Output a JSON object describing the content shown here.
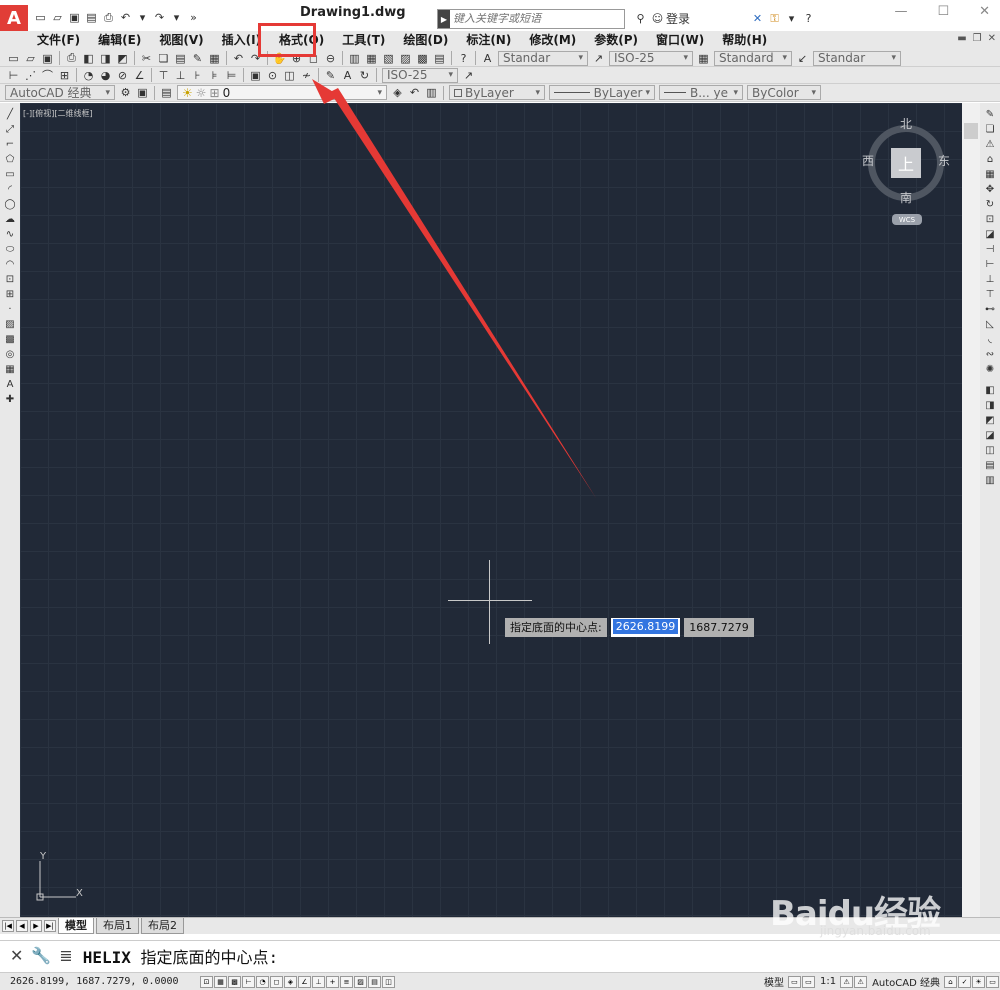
{
  "app": {
    "title": "Drawing1.dwg",
    "logo_letter": "A"
  },
  "search": {
    "placeholder": "键入关键字或短语"
  },
  "login": {
    "label": "登录"
  },
  "menu": [
    "文件(F)",
    "编辑(E)",
    "视图(V)",
    "插入(I)",
    "格式(O)",
    "工具(T)",
    "绘图(D)",
    "标注(N)",
    "修改(M)",
    "参数(P)",
    "窗口(W)",
    "帮助(H)"
  ],
  "styles": {
    "text_style": "Standar",
    "dim_style": "ISO-25",
    "table_style": "Standard",
    "multileader_style": "Standar",
    "dim_style2": "ISO-25"
  },
  "workspace": {
    "name": "AutoCAD 经典",
    "layer": "0",
    "color": "ByLayer",
    "linetype": "ByLayer",
    "lineweight": "B... ye",
    "plotstyle": "ByColor"
  },
  "viewport": {
    "label": "[-][俯视][二维线框]"
  },
  "viewcube": {
    "top": "上",
    "north": "北",
    "south": "南",
    "east": "东",
    "west": "西",
    "wcs": "WCS"
  },
  "prompt": {
    "label": "指定底面的中心点:",
    "x": "2626.8199",
    "y": "1687.7279"
  },
  "ucs": {
    "x": "X",
    "y": "Y"
  },
  "tabs": [
    "模型",
    "布局1",
    "布局2"
  ],
  "command": {
    "name": "HELIX",
    "text": "指定底面的中心点:"
  },
  "status": {
    "coords": "2626.8199, 1687.7279, 0.0000",
    "model": "模型",
    "scale": "1:1",
    "workspace": "AutoCAD 经典"
  },
  "watermark": {
    "main": "Baidu经验",
    "sub": "jingyan.baidu.com"
  },
  "colors": {
    "canvas": "#212937",
    "annotation": "#e53935",
    "accent": "#3375e0"
  }
}
